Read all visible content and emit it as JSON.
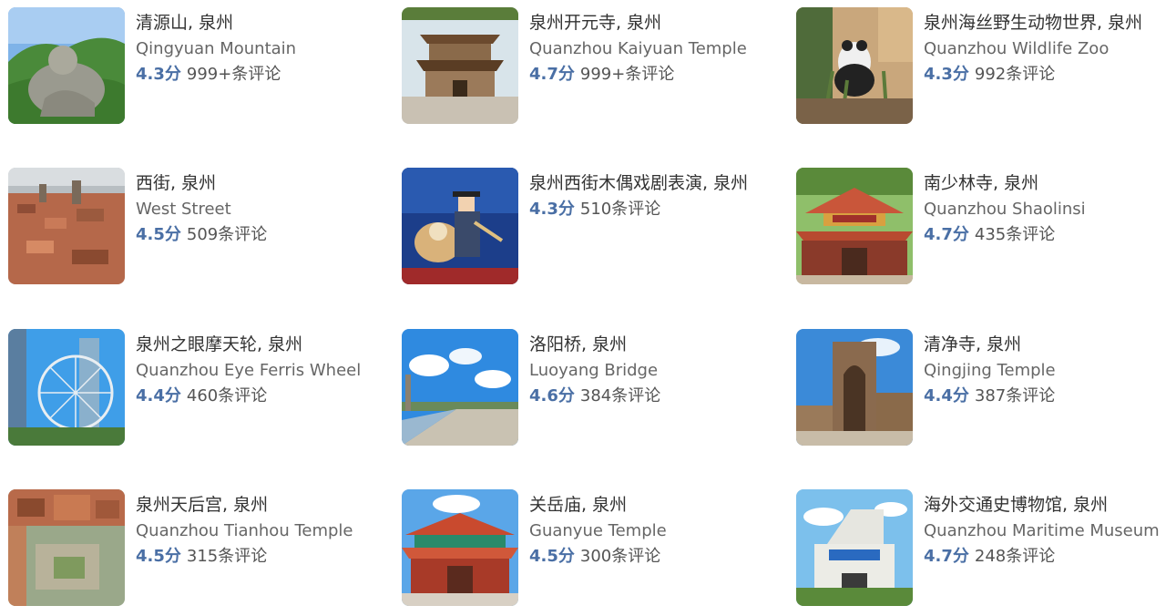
{
  "attractions": [
    {
      "title": "清源山, 泉州",
      "subtitle": "Qingyuan Mountain",
      "score": "4.3分",
      "reviews": "999+条评论"
    },
    {
      "title": "泉州开元寺, 泉州",
      "subtitle": "Quanzhou Kaiyuan Temple",
      "score": "4.7分",
      "reviews": "999+条评论"
    },
    {
      "title": "泉州海丝野生动物世界, 泉州",
      "subtitle": "Quanzhou Wildlife Zoo",
      "score": "4.3分",
      "reviews": "992条评论"
    },
    {
      "title": "西街, 泉州",
      "subtitle": "West Street",
      "score": "4.5分",
      "reviews": "509条评论"
    },
    {
      "title": "泉州西街木偶戏剧表演, 泉州",
      "subtitle": "",
      "score": "4.3分",
      "reviews": "510条评论"
    },
    {
      "title": "南少林寺, 泉州",
      "subtitle": "Quanzhou Shaolinsi",
      "score": "4.7分",
      "reviews": "435条评论"
    },
    {
      "title": "泉州之眼摩天轮, 泉州",
      "subtitle": "Quanzhou Eye Ferris Wheel",
      "score": "4.4分",
      "reviews": "460条评论"
    },
    {
      "title": "洛阳桥, 泉州",
      "subtitle": "Luoyang Bridge",
      "score": "4.6分",
      "reviews": "384条评论"
    },
    {
      "title": "清净寺, 泉州",
      "subtitle": "Qingjing Temple",
      "score": "4.4分",
      "reviews": "387条评论"
    },
    {
      "title": "泉州天后宫, 泉州",
      "subtitle": "Quanzhou Tianhou Temple",
      "score": "4.5分",
      "reviews": "315条评论"
    },
    {
      "title": "关岳庙, 泉州",
      "subtitle": "Guanyue Temple",
      "score": "4.5分",
      "reviews": "300条评论"
    },
    {
      "title": "海外交通史博物馆, 泉州",
      "subtitle": "Quanzhou Maritime Museum",
      "score": "4.7分",
      "reviews": "248条评论"
    }
  ],
  "colors": {
    "title": "#333333",
    "subtitle": "#666666",
    "score": "#4a6fa5",
    "reviews": "#555555"
  }
}
